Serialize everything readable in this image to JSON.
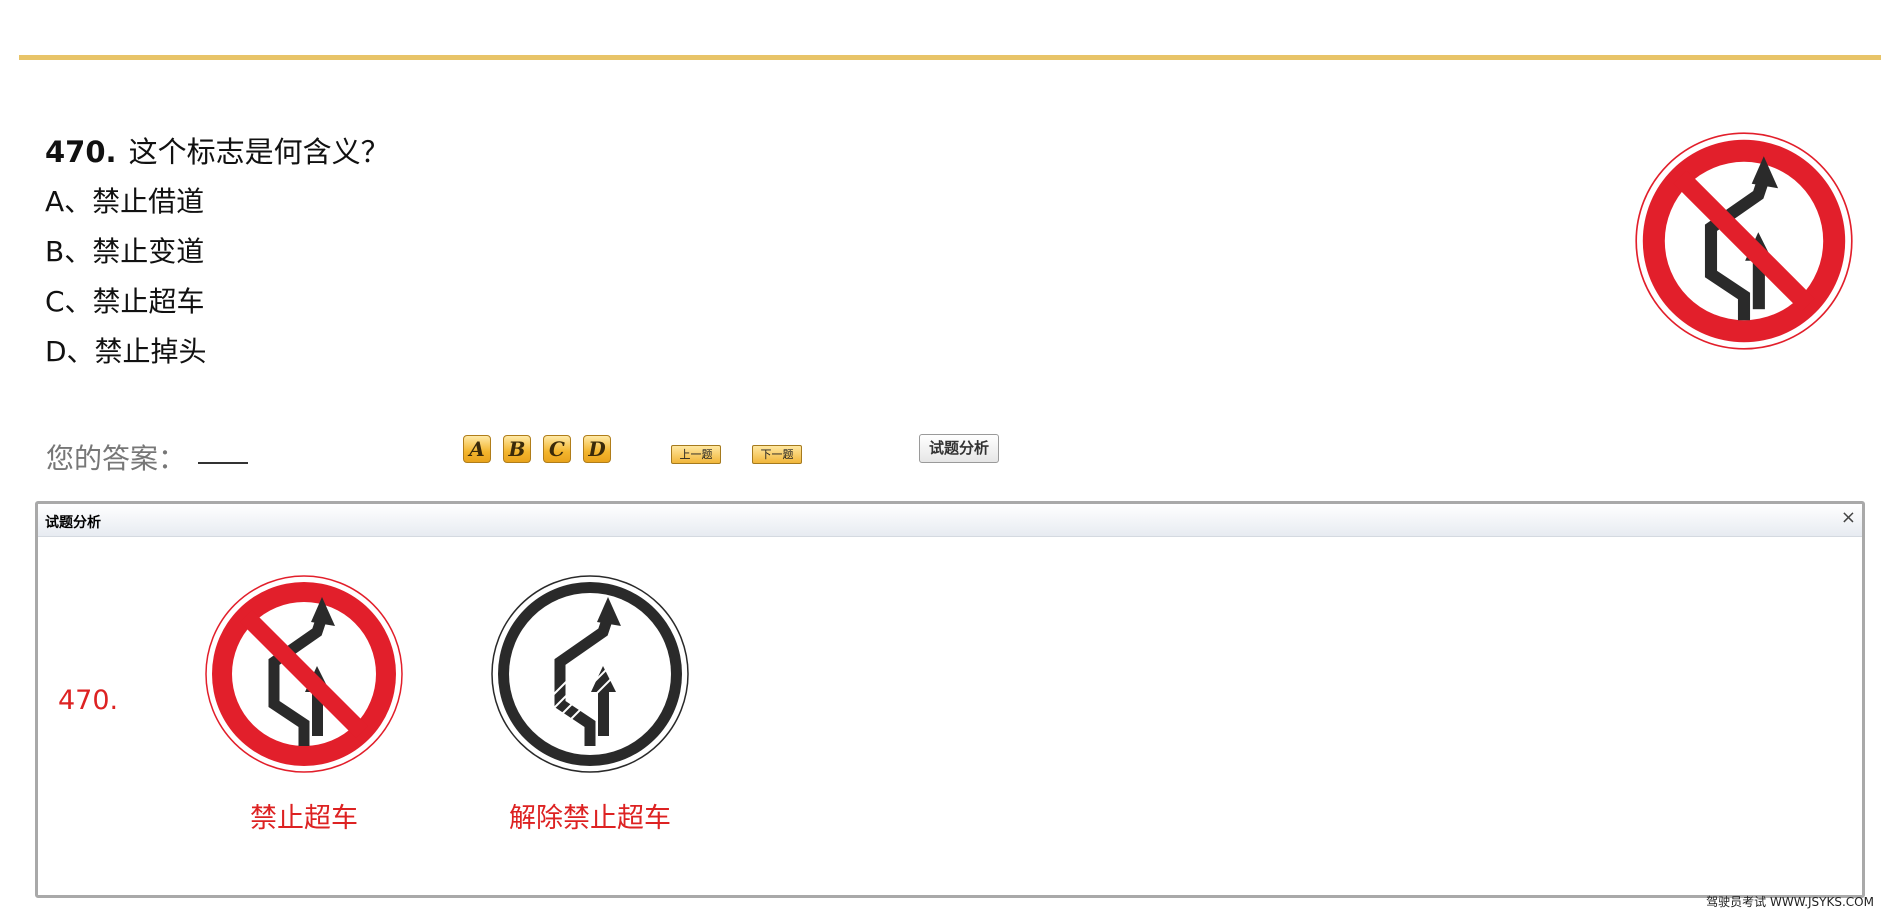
{
  "question": {
    "number": "470.",
    "text": "这个标志是何含义？",
    "options": [
      "A、禁止借道",
      "B、禁止变道",
      "C、禁止超车",
      "D、禁止掉头"
    ],
    "main_sign_icon": "no-overtaking-sign-icon"
  },
  "answer": {
    "label": "您的答案：",
    "value": ""
  },
  "buttons": {
    "options": [
      "A",
      "B",
      "C",
      "D"
    ],
    "prev": "上一题",
    "next": "下一题",
    "analysis": "试题分析"
  },
  "analysis_panel": {
    "title": "试题分析",
    "close": "×",
    "number": "470.",
    "signs": [
      {
        "icon": "no-overtaking-sign-icon",
        "caption": "禁止超车"
      },
      {
        "icon": "end-no-overtaking-sign-icon",
        "caption": "解除禁止超车"
      }
    ]
  },
  "footer": "驾驶员考试 WWW.JSYKS.COM",
  "colors": {
    "accent_line": "#e8c468",
    "sign_red": "#e21f2b",
    "sign_black": "#2a2a2a",
    "caption_red": "#dd2222"
  }
}
